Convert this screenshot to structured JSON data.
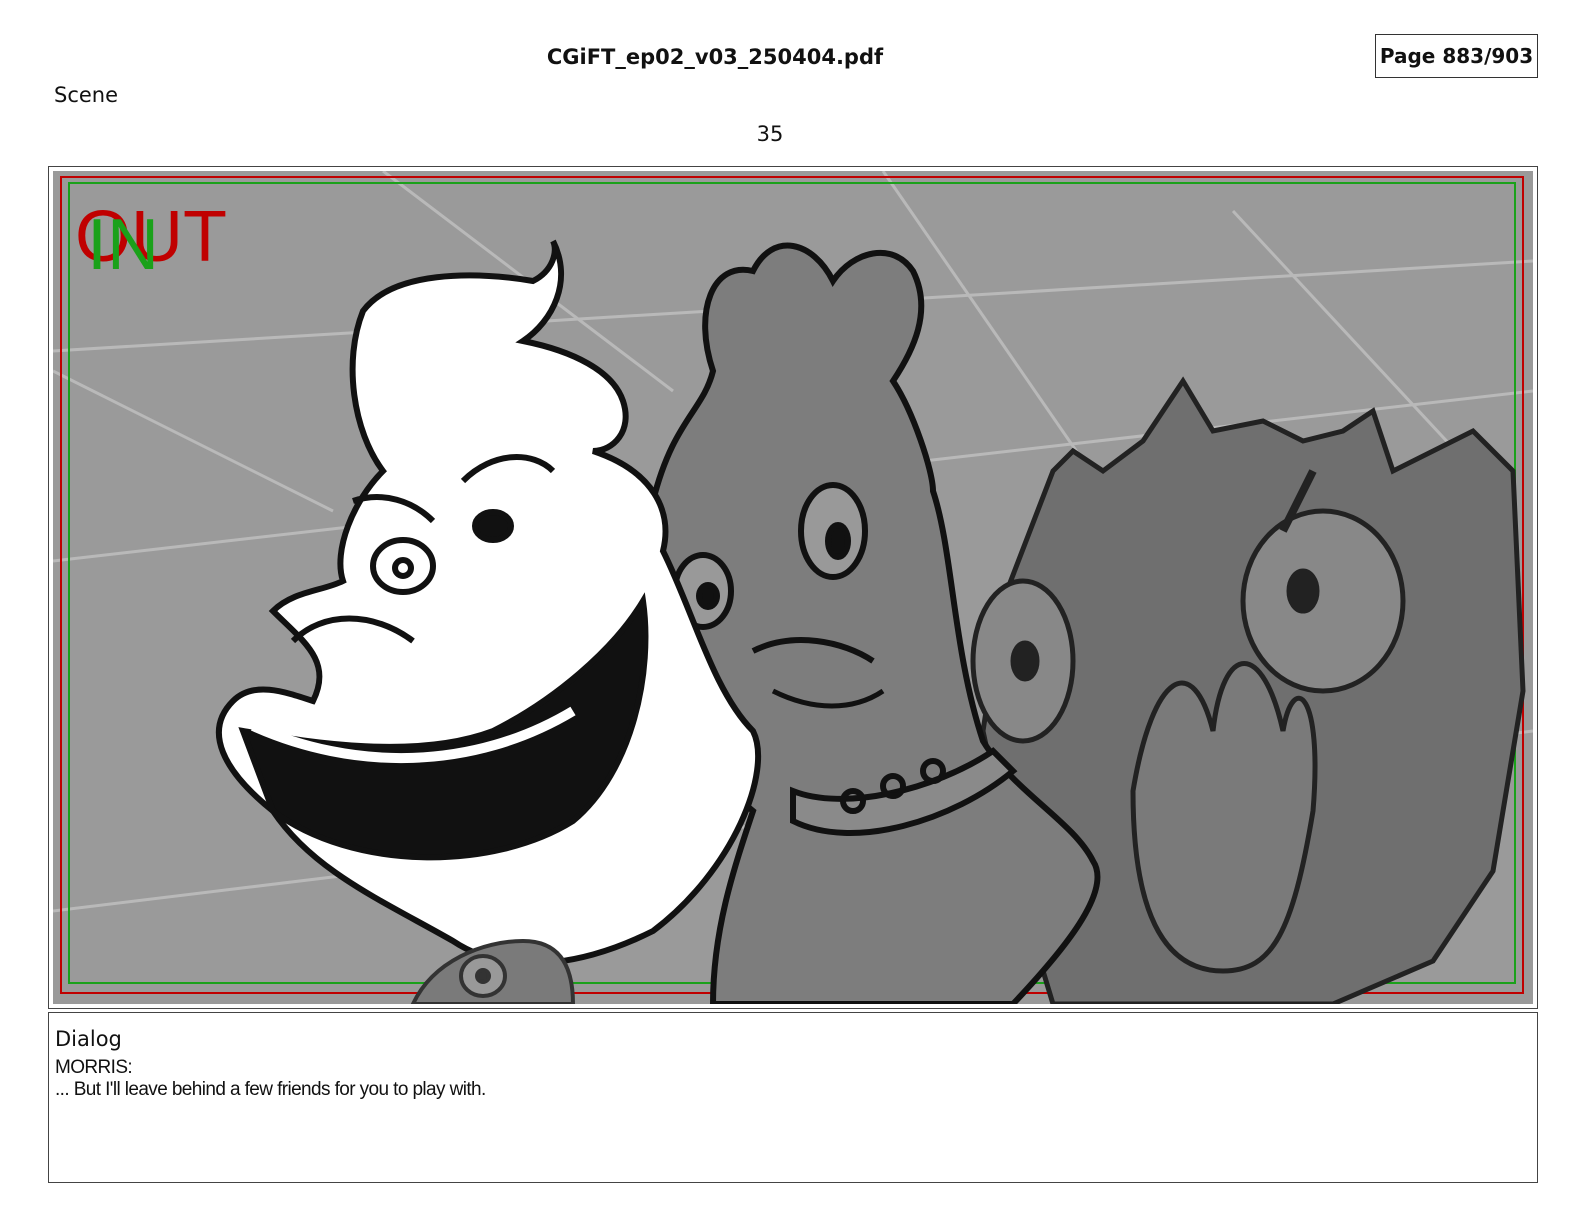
{
  "header": {
    "file_name": "CGiFT_ep02_v03_250404.pdf",
    "page_indicator": "Page 883/903"
  },
  "scene": {
    "label": "Scene",
    "number": "35"
  },
  "panel": {
    "out_marker": "OUT",
    "in_marker": "IN",
    "colors": {
      "background": "#9a9a9a",
      "out_marker": "#c00000",
      "in_marker": "#1aa11a",
      "safe_frame_red": "#c00000",
      "safe_frame_green": "#1aa11a"
    }
  },
  "dialog": {
    "label": "Dialog",
    "speaker": "MORRIS:",
    "line": "... But I'll leave behind a few friends for you to play with."
  }
}
